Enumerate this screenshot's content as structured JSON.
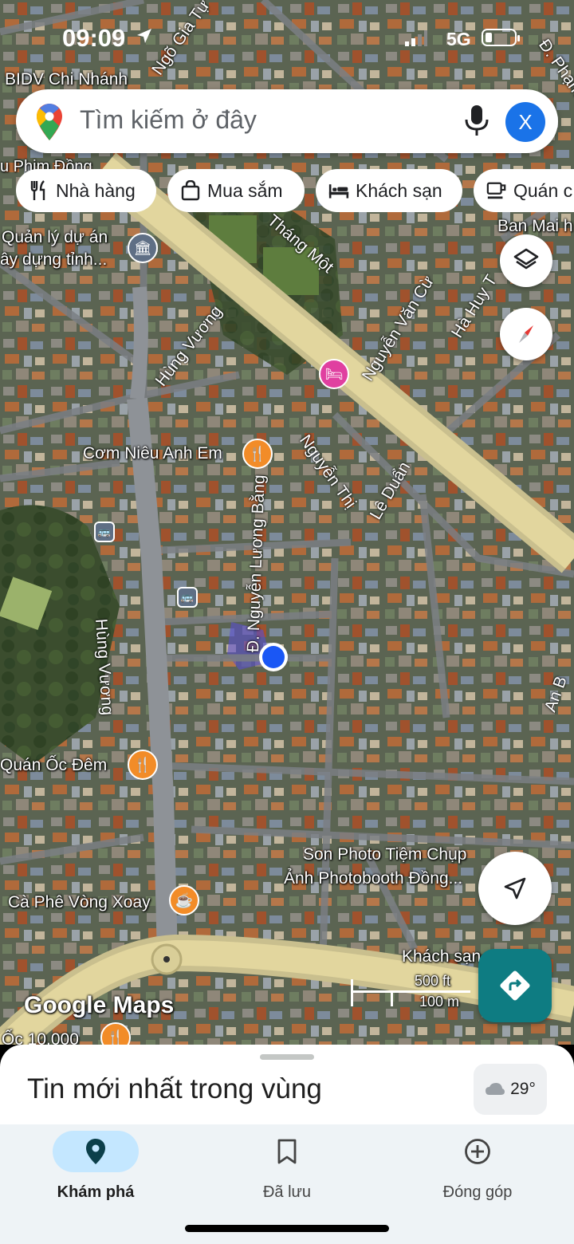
{
  "status_bar": {
    "time": "09:09",
    "network": "5G"
  },
  "search": {
    "placeholder": "Tìm kiếm ở đây",
    "avatar_letter": "X"
  },
  "chips": [
    {
      "label": "Nhà hàng",
      "icon": "restaurant-icon"
    },
    {
      "label": "Mua sắm",
      "icon": "shopping-bag-icon"
    },
    {
      "label": "Khách sạn",
      "icon": "bed-icon"
    },
    {
      "label": "Quán c",
      "icon": "coffee-icon"
    }
  ],
  "map": {
    "places": [
      "BIDV Chi Nhánh",
      "Quản lý dự án",
      "ây dựng tỉnh...",
      "Cơm Niêu Anh Em",
      "Quán Ốc Đêm",
      "Son Photo Tiệm Chụp",
      "Ảnh Photobooth Đồng...",
      "Cà Phê Vòng Xoay",
      "Ốc 10.000",
      "Khách sạn",
      "Ban Mai h",
      "u Phim Đồng"
    ],
    "streets": [
      "Ngõ Gia Tự",
      "Tháng Một",
      "Hùng Vương",
      "Nguyễn Văn Cừ",
      "Hà Huy T",
      "Nguyễn Thị",
      "Lê Duẩn",
      "Đ. Nguyễn Lương Bằng",
      "Đ. Phạm",
      "An B"
    ],
    "watermark": "Google Maps",
    "scale": {
      "top": "500 ft",
      "bottom": "100 m"
    }
  },
  "sheet": {
    "title": "Tin mới nhất trong vùng",
    "temperature": "29°"
  },
  "nav": [
    {
      "label": "Khám phá",
      "icon": "explore-pin-icon",
      "active": true
    },
    {
      "label": "Đã lưu",
      "icon": "bookmark-icon",
      "active": false
    },
    {
      "label": "Đóng góp",
      "icon": "add-circle-icon",
      "active": false
    }
  ]
}
